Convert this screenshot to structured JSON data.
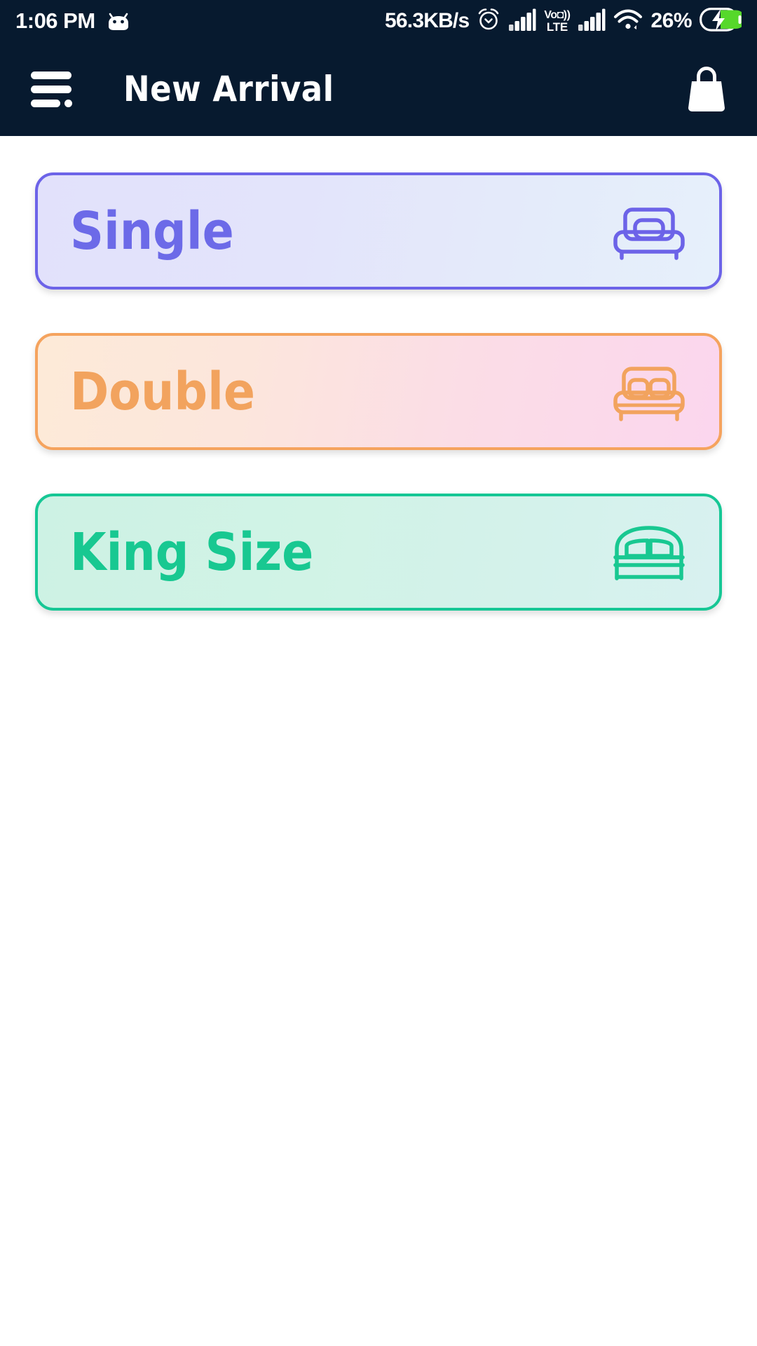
{
  "status_bar": {
    "time": "1:06 PM",
    "android_icon": "android-head-icon",
    "network_speed": "56.3KB/s",
    "alarm_icon": "alarm-clock-icon",
    "signal_1_icon": "signal-bars-icon",
    "volte_top": "Vo",
    "volte_bottom": "LTE",
    "signal_2_icon": "signal-bars-icon",
    "wifi_icon": "wifi-icon",
    "battery_percent": "26%",
    "battery_icon": "battery-charging-icon",
    "background_color": "#071A2F",
    "foreground_color": "#FFFFFF"
  },
  "app_bar": {
    "menu_icon": "hamburger-menu-icon",
    "title": "New Arrival",
    "bag_icon": "shopping-bag-icon",
    "background_color": "#071A2F"
  },
  "main": {
    "cards": [
      {
        "label": "Single",
        "icon": "single-bed-icon",
        "accent_color": "#6C63E8",
        "text_color": "#6C6AE8",
        "gradient_from": "#E2E1FB",
        "gradient_to": "#E6F0FB"
      },
      {
        "label": "Double",
        "icon": "double-bed-icon",
        "accent_color": "#F5A35E",
        "text_color": "#F2A35E",
        "gradient_from": "#FDEAD8",
        "gradient_to": "#FBD6EE"
      },
      {
        "label": "King Size",
        "icon": "king-bed-icon",
        "accent_color": "#16C795",
        "text_color": "#18C891",
        "gradient_from": "#CDF2E4",
        "gradient_to": "#D8F1F0"
      }
    ],
    "background_color": "#FFFFFF"
  }
}
